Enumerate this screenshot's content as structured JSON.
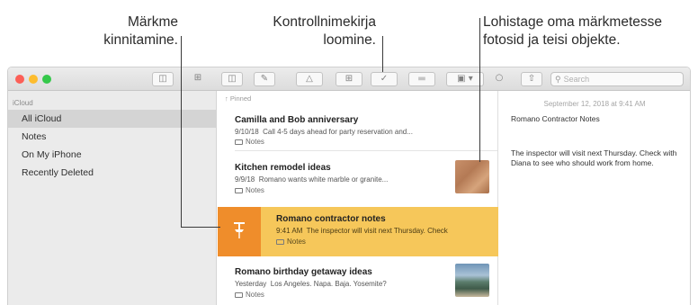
{
  "callouts": {
    "pin": [
      "Märkme",
      "kinnitamine."
    ],
    "checklist": [
      "Kontrollnimekirja",
      "loomine."
    ],
    "drag": [
      "Lohistage oma märkmetesse",
      "fotosid ja teisi objekte."
    ]
  },
  "search": {
    "placeholder": "Search"
  },
  "toolbar": {
    "icons": [
      "sidebar-toggle-icon",
      "attachments-grid-icon",
      "trash-icon",
      "new-note-icon",
      "lock-icon",
      "table-icon",
      "checklist-icon",
      "format-icon",
      "media-icon",
      "collaborate-icon",
      "share-icon",
      "search-icon"
    ]
  },
  "sidebar": {
    "header": "iCloud",
    "items": [
      {
        "label": "All iCloud",
        "selected": true
      },
      {
        "label": "Notes",
        "selected": false
      },
      {
        "label": "On My iPhone",
        "selected": false
      },
      {
        "label": "Recently Deleted",
        "selected": false
      }
    ]
  },
  "list": {
    "pinned_label": "Pinned",
    "notes": [
      {
        "title": "Camilla and Bob anniversary",
        "date": "9/10/18",
        "snippet": "Call 4-5 days ahead for party reservation and...",
        "folder": "Notes"
      },
      {
        "title": "Kitchen remodel ideas",
        "date": "9/9/18",
        "snippet": "Romano wants white marble or granite...",
        "folder": "Notes"
      },
      {
        "title": "Romano contractor notes",
        "date": "9:41 AM",
        "snippet": "The inspector will visit next Thursday. Check",
        "folder": "Notes"
      },
      {
        "title": "Romano birthday getaway ideas",
        "date": "Yesterday",
        "snippet": "Los Angeles. Napa. Baja. Yosemite?",
        "folder": "Notes"
      }
    ]
  },
  "detail": {
    "date": "September 12, 2018 at 9:41 AM",
    "title": "Romano Contractor Notes",
    "body": "The inspector will visit next Thursday. Check with Diana to see who should work from home."
  },
  "colors": {
    "active_note": "#f6c75a",
    "pin_box": "#ef8d2b",
    "traffic_red": "#fc5f57",
    "traffic_yellow": "#fdbc2e",
    "traffic_green": "#34c84a"
  }
}
